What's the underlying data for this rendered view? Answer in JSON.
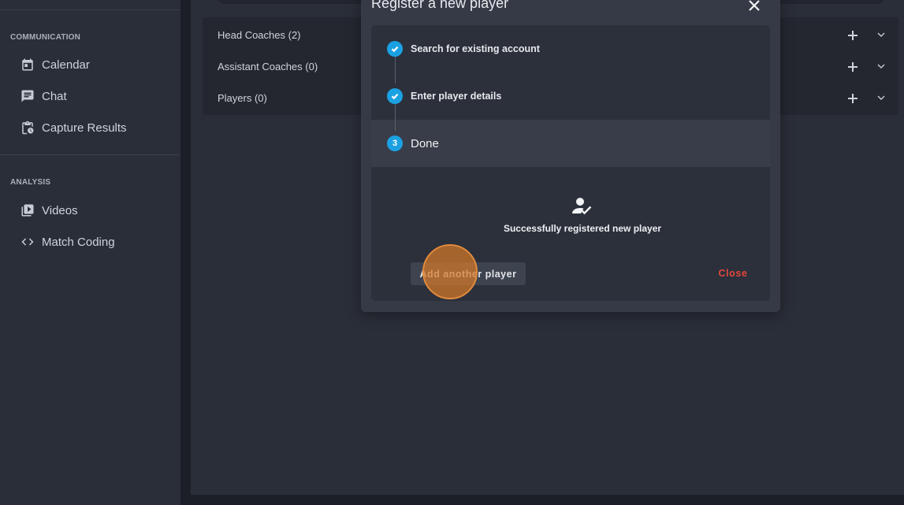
{
  "sidebar": {
    "sections": [
      {
        "title": "COMMUNICATION",
        "items": [
          {
            "label": "Calendar",
            "icon": "calendar-icon"
          },
          {
            "label": "Chat",
            "icon": "chat-icon"
          },
          {
            "label": "Capture Results",
            "icon": "clipboard-icon"
          }
        ]
      },
      {
        "title": "ANALYSIS",
        "items": [
          {
            "label": "Videos",
            "icon": "video-library-icon"
          },
          {
            "label": "Match Coding",
            "icon": "code-icon"
          }
        ]
      }
    ]
  },
  "roster": {
    "rows": [
      {
        "label": "Head Coaches (2)"
      },
      {
        "label": "Assistant Coaches (0)"
      },
      {
        "label": "Players (0)"
      }
    ]
  },
  "modal": {
    "title": "Register a new player",
    "steps": [
      {
        "label": "Search for existing account",
        "state": "complete"
      },
      {
        "label": "Enter player details",
        "state": "complete"
      },
      {
        "label": "Done",
        "number": "3",
        "state": "active"
      }
    ],
    "success_message": "Successfully registered new player",
    "add_another_label": "Add another player",
    "close_label": "Close"
  },
  "colors": {
    "accent": "#1ba1e2",
    "danger": "#e2483c",
    "click_marker": "#d67828"
  }
}
